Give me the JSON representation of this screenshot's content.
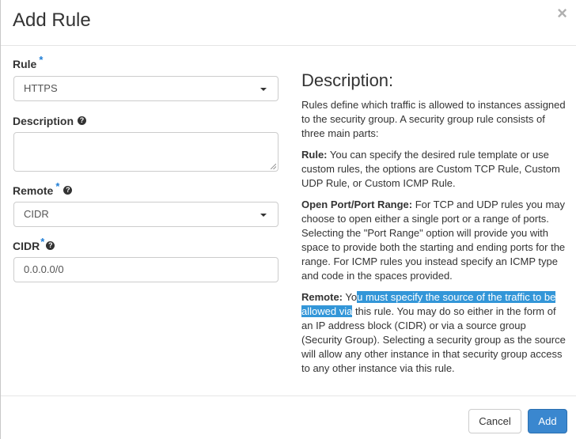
{
  "modal": {
    "title": "Add Rule",
    "close_glyph": "×"
  },
  "form": {
    "rule": {
      "label": "Rule",
      "required_mark": "*",
      "value": "HTTPS"
    },
    "description": {
      "label": "Description",
      "help_glyph": "?",
      "value": ""
    },
    "remote": {
      "label": "Remote",
      "required_mark": "*",
      "help_glyph": "?",
      "value": "CIDR"
    },
    "cidr": {
      "label": "CIDR",
      "required_mark": "*",
      "help_glyph": "?",
      "value": "0.0.0.0/0"
    }
  },
  "description_panel": {
    "heading": "Description:",
    "intro": "Rules define which traffic is allowed to instances assigned to the security group. A security group rule consists of three main parts:",
    "rule_term": "Rule:",
    "rule_text": " You can specify the desired rule template or use custom rules, the options are Custom TCP Rule, Custom UDP Rule, or Custom ICMP Rule.",
    "port_term": "Open Port/Port Range:",
    "port_text": " For TCP and UDP rules you may choose to open either a single port or a range of ports. Selecting the \"Port Range\" option will provide you with space to provide both the starting and ending ports for the range. For ICMP rules you instead specify an ICMP type and code in the spaces provided.",
    "remote_term": "Remote:",
    "remote_text_before": " Yo",
    "remote_text_selected": "u must specify the source of the traffic to be allowed via",
    "remote_text_after": " this rule. You may do so either in the form of an IP address block (CIDR) or via a source group (Security Group). Selecting a security group as the source will allow any other instance in that security group access to any other instance via this rule."
  },
  "footer": {
    "cancel_label": "Cancel",
    "add_label": "Add"
  },
  "colors": {
    "primary": "#3a87cf",
    "required": "#1f7ed6",
    "selection": "#3396d8"
  },
  "icons": {
    "close": "close-icon",
    "help": "help-icon",
    "dropdown": "chevron-down-icon"
  }
}
